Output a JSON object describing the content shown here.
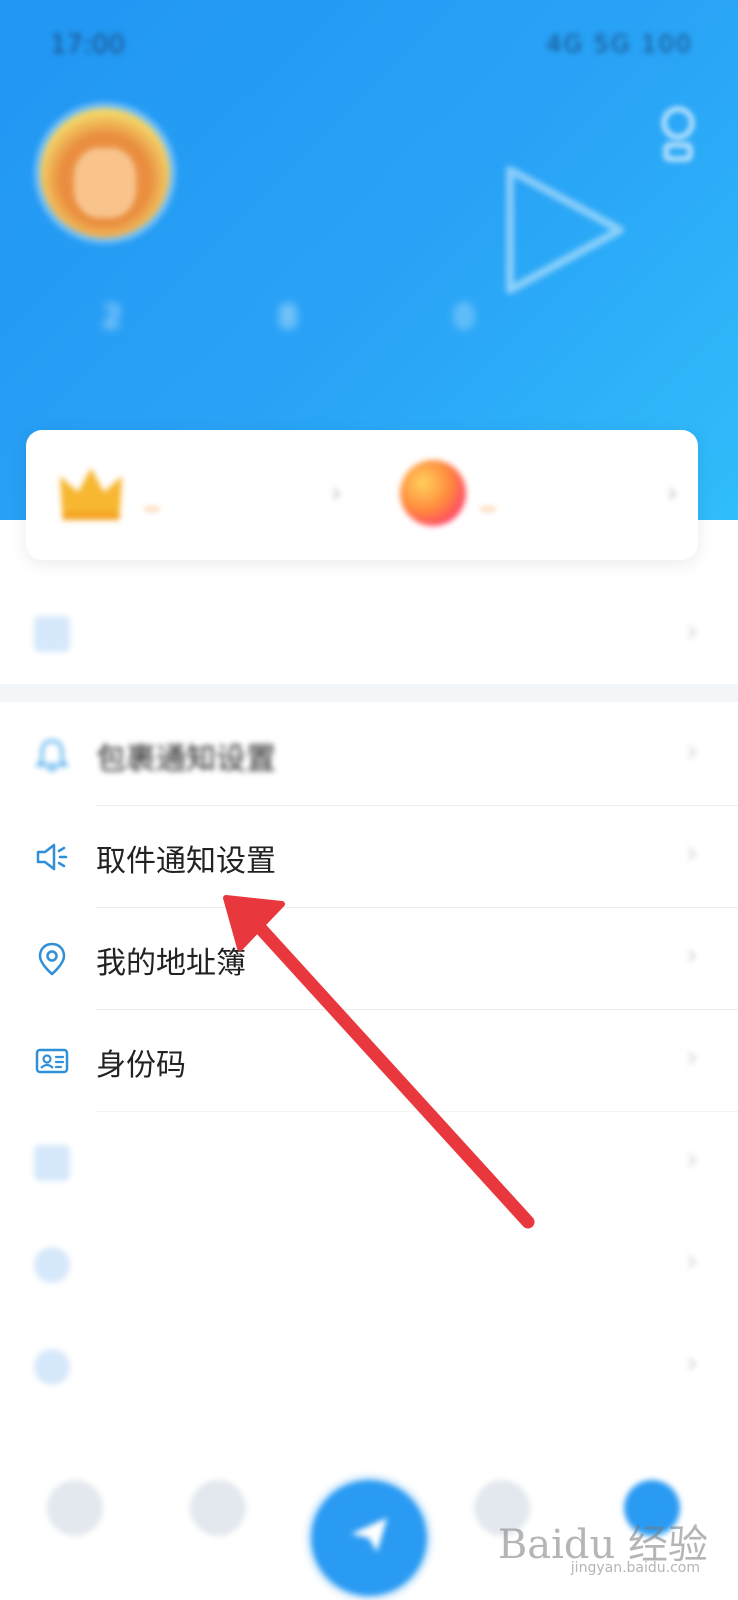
{
  "status_bar": {
    "time": "17:00",
    "icons": "4G 5G 100"
  },
  "profile": {
    "name": "",
    "subtitle": ""
  },
  "stats": [
    {
      "num": "2",
      "label": ""
    },
    {
      "num": "8",
      "label": ""
    },
    {
      "num": "0",
      "label": ""
    }
  ],
  "cards": [
    {
      "title": "",
      "sub": "",
      "icon": "crown-icon"
    },
    {
      "title": "",
      "sub": "",
      "icon": "points-icon"
    }
  ],
  "top_row": {
    "label": "",
    "right": ""
  },
  "menu": [
    {
      "label": "包裹通知设置",
      "icon": "bell-icon",
      "right": ""
    },
    {
      "label": "取件通知设置",
      "icon": "speaker-icon",
      "right": ""
    },
    {
      "label": "我的地址簿",
      "icon": "location-pin-icon",
      "right": ""
    },
    {
      "label": "身份码",
      "icon": "id-card-icon",
      "right": ""
    },
    {
      "label": "",
      "icon": "pass-icon",
      "right": ""
    },
    {
      "label": "",
      "icon": "service-icon",
      "right": ""
    },
    {
      "label": "",
      "icon": "feedback-icon",
      "right": ""
    }
  ],
  "bottom_nav": [
    {
      "label": "",
      "icon": "home-icon"
    },
    {
      "label": "",
      "icon": "orders-icon"
    },
    {
      "label": "",
      "icon": "send-icon"
    },
    {
      "label": "",
      "icon": "station-icon"
    },
    {
      "label": "",
      "icon": "me-icon"
    }
  ],
  "colors": {
    "header_start": "#2196f3",
    "header_end": "#31bdfb",
    "accent": "#2a9bf3",
    "arrow": "#e8383d"
  },
  "watermark": {
    "text": "Baidu 经验",
    "sub": "jingyan.baidu.com"
  }
}
